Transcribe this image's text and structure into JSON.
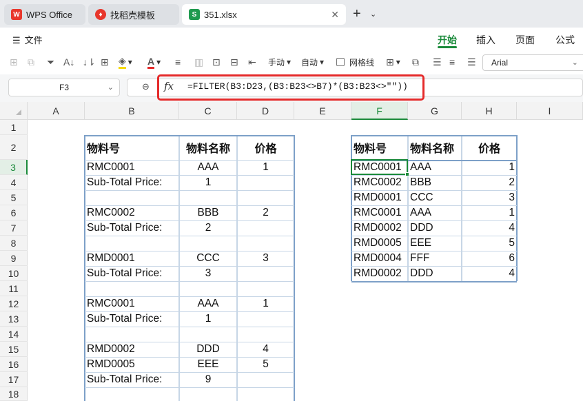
{
  "tabs": {
    "wps": "WPS Office",
    "template": "找稻壳模板",
    "file": "351.xlsx",
    "file_icon": "S"
  },
  "menu": {
    "file": "文件",
    "ribbon": [
      "开始",
      "插入",
      "页面",
      "公式"
    ]
  },
  "toolbar": {
    "manual": "手动",
    "auto": "自动",
    "gridlines": "网格线",
    "font": "Arial"
  },
  "formula_bar": {
    "name_box": "F3",
    "fx": "fx",
    "formula": "=FILTER(B3:D23,(B3:B23<>B7)*(B3:B23<>\"\"))"
  },
  "grid": {
    "columns": [
      "A",
      "B",
      "C",
      "D",
      "E",
      "F",
      "G",
      "H",
      "I"
    ],
    "rows": [
      "1",
      "2",
      "3",
      "4",
      "5",
      "6",
      "7",
      "8",
      "9",
      "10",
      "11",
      "12",
      "13",
      "14",
      "15",
      "16",
      "17",
      "18"
    ],
    "selected_col": "F",
    "selected_row": "3"
  },
  "left_table": {
    "headers": [
      "物料号",
      "物料名称",
      "价格"
    ],
    "rows": [
      [
        "RMC0001",
        "AAA",
        "1"
      ],
      [
        "Sub-Total Price:",
        "1",
        ""
      ],
      [
        "",
        "",
        ""
      ],
      [
        "RMC0002",
        "BBB",
        "2"
      ],
      [
        "Sub-Total Price:",
        "2",
        ""
      ],
      [
        "",
        "",
        ""
      ],
      [
        "RMD0001",
        "CCC",
        "3"
      ],
      [
        "Sub-Total Price:",
        "3",
        ""
      ],
      [
        "",
        "",
        ""
      ],
      [
        "RMC0001",
        "AAA",
        "1"
      ],
      [
        "Sub-Total Price:",
        "1",
        ""
      ],
      [
        "",
        "",
        ""
      ],
      [
        "RMD0002",
        "DDD",
        "4"
      ],
      [
        "RMD0005",
        "EEE",
        "5"
      ],
      [
        "Sub-Total Price:",
        "9",
        ""
      ],
      [
        "",
        "",
        ""
      ]
    ]
  },
  "right_table": {
    "headers": [
      "物料号",
      "物料名称",
      "价格"
    ],
    "rows": [
      [
        "RMC0001",
        "AAA",
        "1"
      ],
      [
        "RMC0002",
        "BBB",
        "2"
      ],
      [
        "RMD0001",
        "CCC",
        "3"
      ],
      [
        "RMC0001",
        "AAA",
        "1"
      ],
      [
        "RMD0002",
        "DDD",
        "4"
      ],
      [
        "RMD0005",
        "EEE",
        "5"
      ],
      [
        "RMD0004",
        "FFF",
        "6"
      ],
      [
        "RMD0002",
        "DDD",
        "4"
      ]
    ]
  },
  "colors": {
    "accent": "#1a8a3a",
    "highlight": "#e52a2a",
    "table_border": "#7da0c8",
    "wps_red": "#e8372c"
  }
}
